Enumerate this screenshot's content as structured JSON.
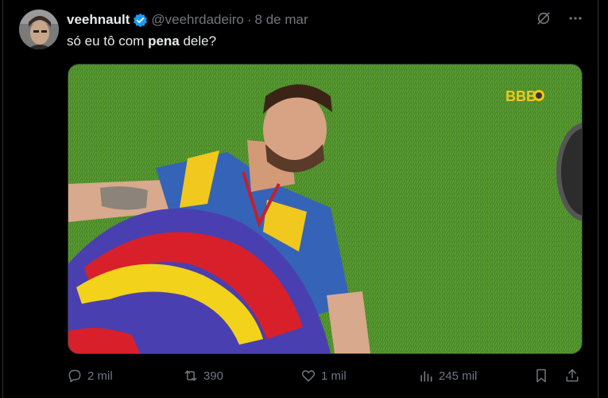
{
  "tweet": {
    "display_name": "veehnault",
    "handle": "@veehrdadeiro",
    "separator": "·",
    "date": "8 de mar",
    "text_before": "só eu tô com ",
    "text_bold": "pena",
    "text_after": " dele?",
    "media_watermark": "BBB",
    "media_icon": "photo",
    "verified_icon": "verified-badge-icon"
  },
  "header_actions": {
    "grok_icon": "grok-icon",
    "more_icon": "more-icon"
  },
  "actions": {
    "replies": "2 mil",
    "reposts": "390",
    "likes": "1 mil",
    "views": "245 mil"
  },
  "colors": {
    "background": "#000000",
    "text_primary": "#e7e9ea",
    "text_secondary": "#71767b",
    "verified": "#1d9bf0"
  }
}
